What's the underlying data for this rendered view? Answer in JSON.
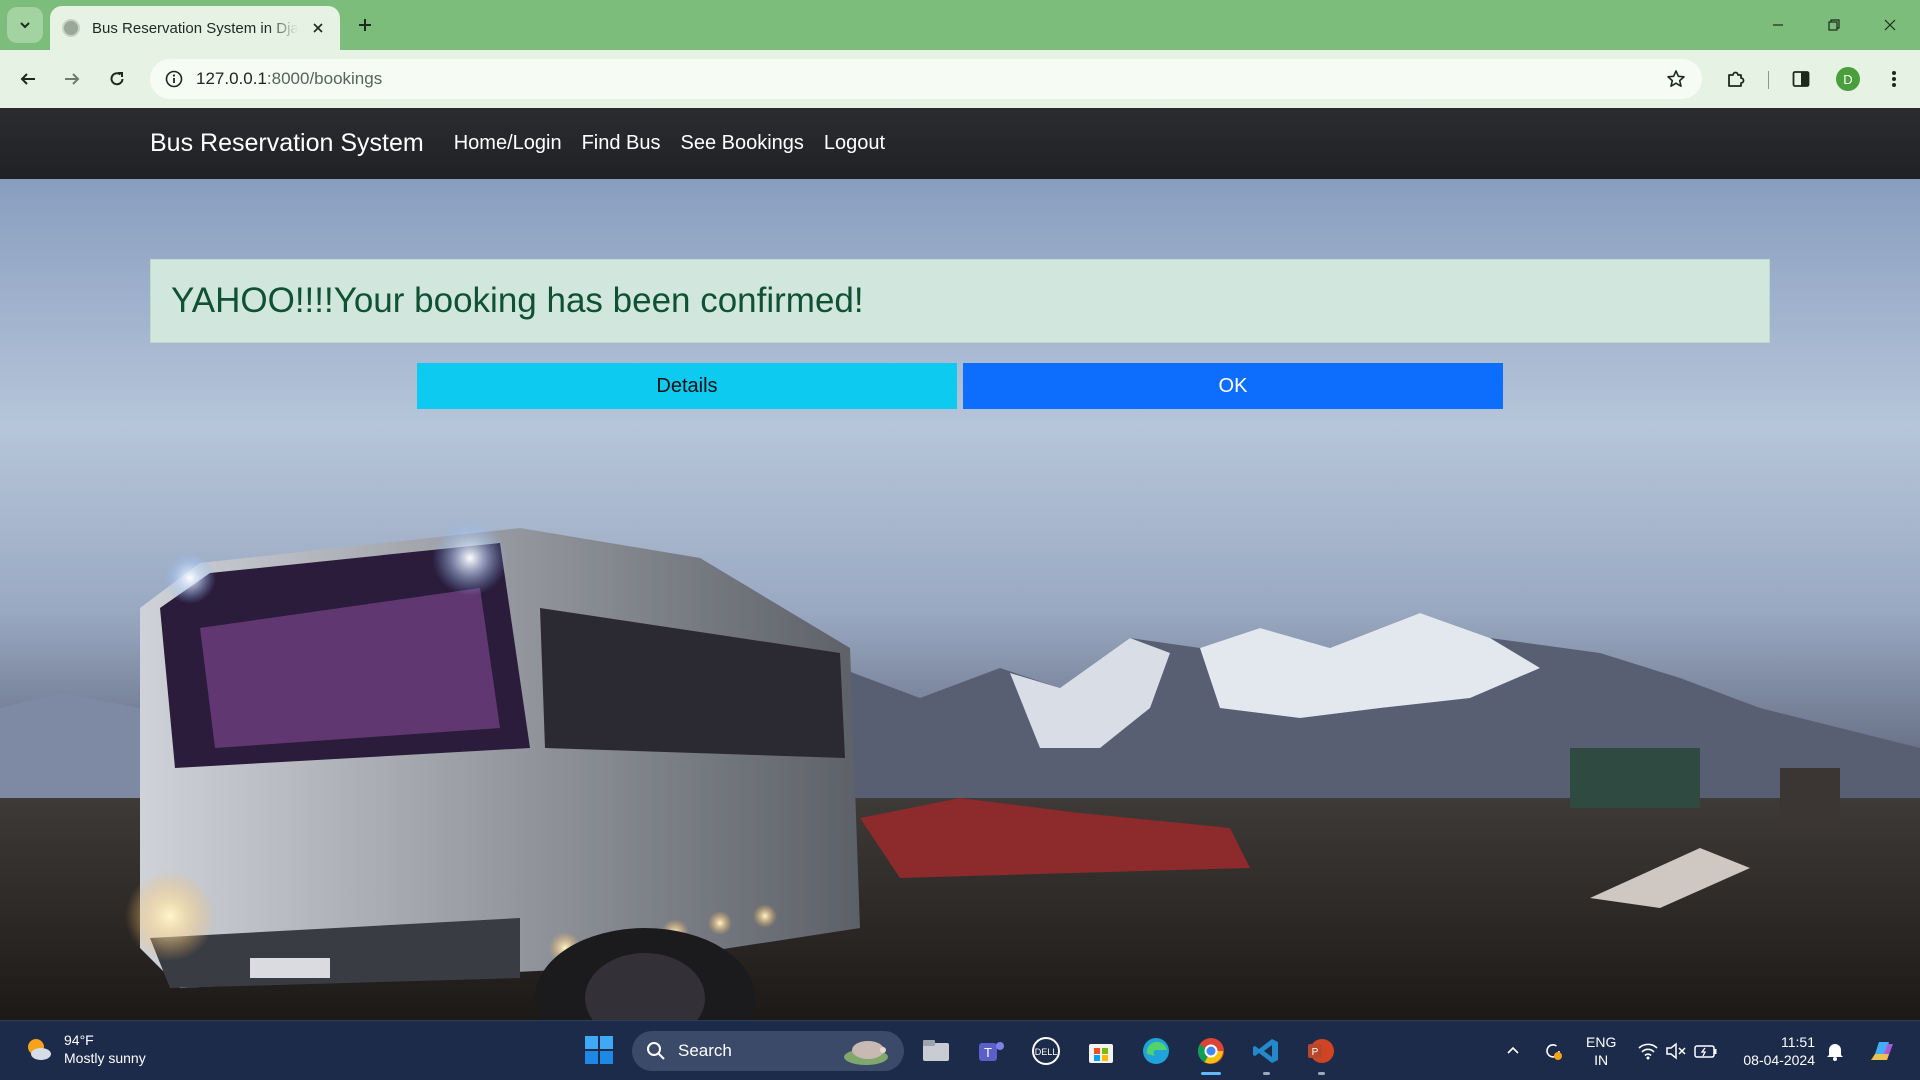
{
  "browser": {
    "tab_title": "Bus Reservation System in Django",
    "url_host": "127.0.0.1",
    "url_path": ":8000/bookings",
    "profile_initial": "D"
  },
  "page": {
    "brand": "Bus Reservation System",
    "nav": [
      "Home/Login",
      "Find Bus",
      "See Bookings",
      "Logout"
    ],
    "alert_message": "YAHOO!!!!Your booking has been confirmed!",
    "details_button": "Details",
    "ok_button": "OK",
    "colors": {
      "navbar": "#212529",
      "alert_bg": "#d1e7dd",
      "alert_text": "#0f5132",
      "details_button": "#0dcaf0",
      "ok_button": "#0d6efd"
    }
  },
  "taskbar": {
    "temperature": "94°F",
    "weather": "Mostly sunny",
    "search_label": "Search",
    "apps": [
      "file-explorer",
      "teams",
      "dell",
      "microsoft-store",
      "edge",
      "chrome",
      "vscode",
      "powerpoint"
    ],
    "language": "ENG",
    "region": "IN",
    "time": "11:51",
    "date": "08-04-2024"
  }
}
